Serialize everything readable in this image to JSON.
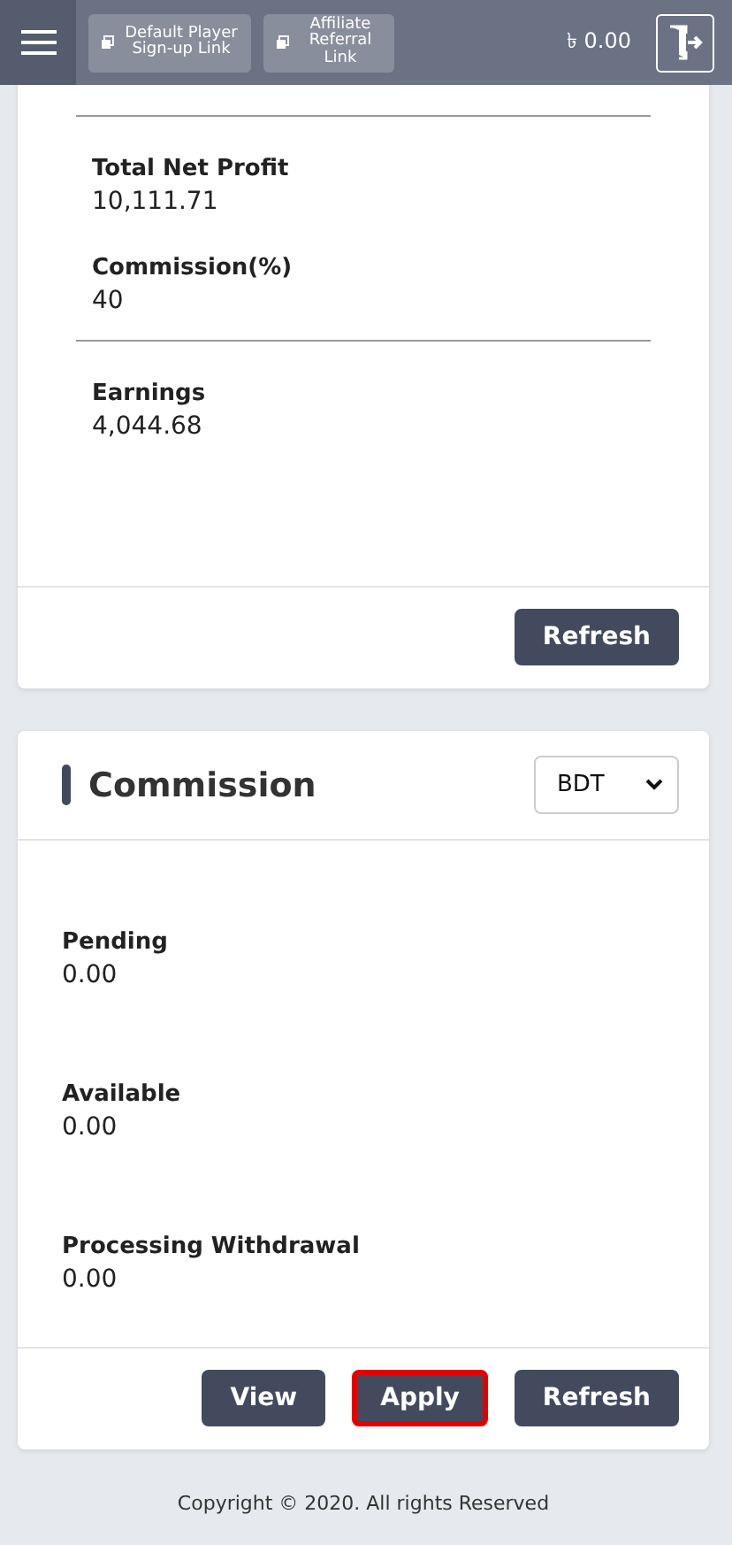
{
  "header": {
    "links": [
      {
        "label": "Default Player Sign-up Link"
      },
      {
        "label": "Affiliate Referral Link"
      }
    ],
    "balance": "৳ 0.00"
  },
  "summary": {
    "items": [
      {
        "kind": "divider"
      },
      {
        "kind": "field",
        "label": "Total Net Profit",
        "value": "10,111.71"
      },
      {
        "kind": "field",
        "label": "Commission(%)",
        "value": "40"
      },
      {
        "kind": "divider"
      },
      {
        "kind": "field",
        "label": "Earnings",
        "value": "4,044.68"
      }
    ],
    "buttons": [
      {
        "label": "Refresh",
        "highlighted": false
      }
    ]
  },
  "commission": {
    "title": "Commission",
    "currency": "BDT",
    "fields": [
      {
        "label": "Pending",
        "value": "0.00"
      },
      {
        "label": "Available",
        "value": "0.00"
      },
      {
        "label": "Processing Withdrawal",
        "value": "0.00"
      }
    ],
    "buttons": [
      {
        "label": "View",
        "highlighted": false
      },
      {
        "label": "Apply",
        "highlighted": true
      },
      {
        "label": "Refresh",
        "highlighted": false
      }
    ]
  },
  "footer": "Copyright © 2020. All rights Reserved"
}
